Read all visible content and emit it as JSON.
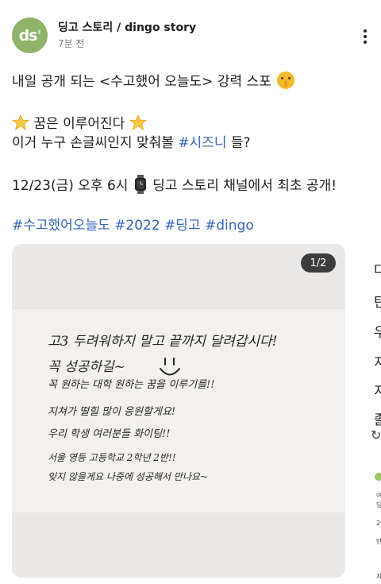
{
  "header": {
    "avatar_text": "ds",
    "avatar_dot": "'",
    "page_name": "딩고 스토리 / dingo story",
    "post_time": "7분 전"
  },
  "post": {
    "line1_text": "내일 공개 되는 <수고했어 오늘도> 강력 스포",
    "line2_text": "꿈은 이루어진다",
    "line3_prefix": "이거 누구 손글씨인지 맞춰볼",
    "line3_hashtag": "#시즈니",
    "line3_suffix": " 들?",
    "line4_before": "12/23(금) 오후 6시",
    "line4_after": " 딩고 스토리 채널에서 최초 공개!",
    "hashtags": [
      "#수고했어오늘도",
      "#2022",
      "#딩고",
      "#dingo"
    ]
  },
  "carousel": {
    "counter": "1/2",
    "handwriting": [
      "고3 두려워하지 말고 끝까지 달려갑시다!",
      "꼭 성공하길~",
      "꼭 원하는 대학 원하는 꿈을 이루기를!!",
      "지쳐가 떨힐 많이 응원할게요!",
      "우리 학생 여러분들 화이팅!!",
      "서울 영등 고등학교 2학년 2반!!",
      "잊지 않을게요 나중에 성공해서 만나요~"
    ]
  },
  "next_card": {
    "chars": [
      "다",
      "탄",
      "우",
      "지",
      "지",
      "졸"
    ],
    "small_chars": [
      "여",
      "딩",
      "20",
      "만",
      "",
      "자"
    ]
  },
  "colors": {
    "hashtag": "#3562b8",
    "avatar_bg": "#8fb369"
  }
}
